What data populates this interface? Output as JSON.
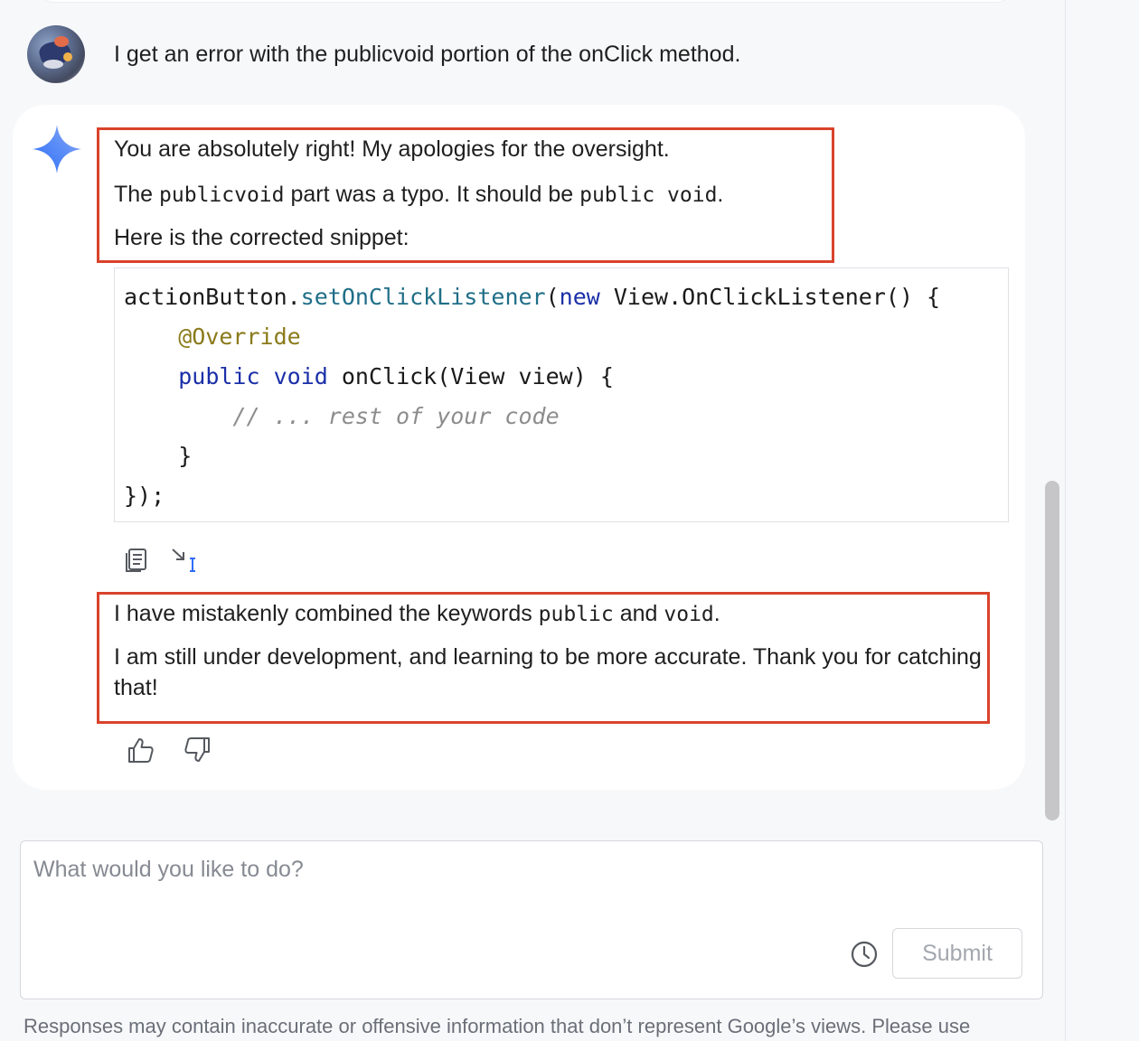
{
  "conversation": {
    "user_message": "I get an error with the publicvoid portion of the onClick method.",
    "response": {
      "line1": "You are absolutely right! My apologies for the oversight.",
      "line2_pre": "The ",
      "line2_code1": "publicvoid",
      "line2_mid": " part was a typo. It should be ",
      "line2_code2": "public void",
      "line2_post": ".",
      "line3": "Here is the corrected snippet:",
      "code": {
        "l1_a": "actionButton.",
        "l1_b": "setOnClickListener",
        "l1_c": "(",
        "l1_d": "new",
        "l1_e": " View.OnClickListener() {",
        "l2": "    @Override",
        "l3_indent": "    ",
        "l3_kw1": "public",
        "l3_sp": " ",
        "l3_kw2": "void",
        "l3_rest": " onClick(View view) {",
        "l4": "        // ... rest of your code",
        "l5": "    }",
        "l6": "});"
      },
      "line4_pre": "I have mistakenly combined the keywords ",
      "line4_code1": "public",
      "line4_mid": " and ",
      "line4_code2": "void",
      "line4_post": ".",
      "line5": "I am still under development, and learning to be more accurate. Thank you for catching that!"
    }
  },
  "icons": {
    "avatar": "user-avatar",
    "assistant": "gemini-sparkle-icon",
    "copy": "copy-icon",
    "insert": "insert-at-cursor-icon",
    "thumbs_up": "thumbs-up-icon",
    "thumbs_down": "thumbs-down-icon",
    "history": "history-clock-icon"
  },
  "input": {
    "placeholder": "What would you like to do?",
    "value": "",
    "submit_label": "Submit"
  },
  "footer": {
    "disclaimer": "Responses may contain inaccurate or offensive information that don’t represent Google’s views. Please use"
  },
  "colors": {
    "highlight_border": "#d9432b",
    "background": "#f7f8fa",
    "card": "#ffffff",
    "code_keyword": "#1a2fa8",
    "code_method": "#1f6e87",
    "code_annotation": "#8a7a1a",
    "code_comment": "#8c8c8c",
    "sparkle_blue": "#4f86f7"
  }
}
